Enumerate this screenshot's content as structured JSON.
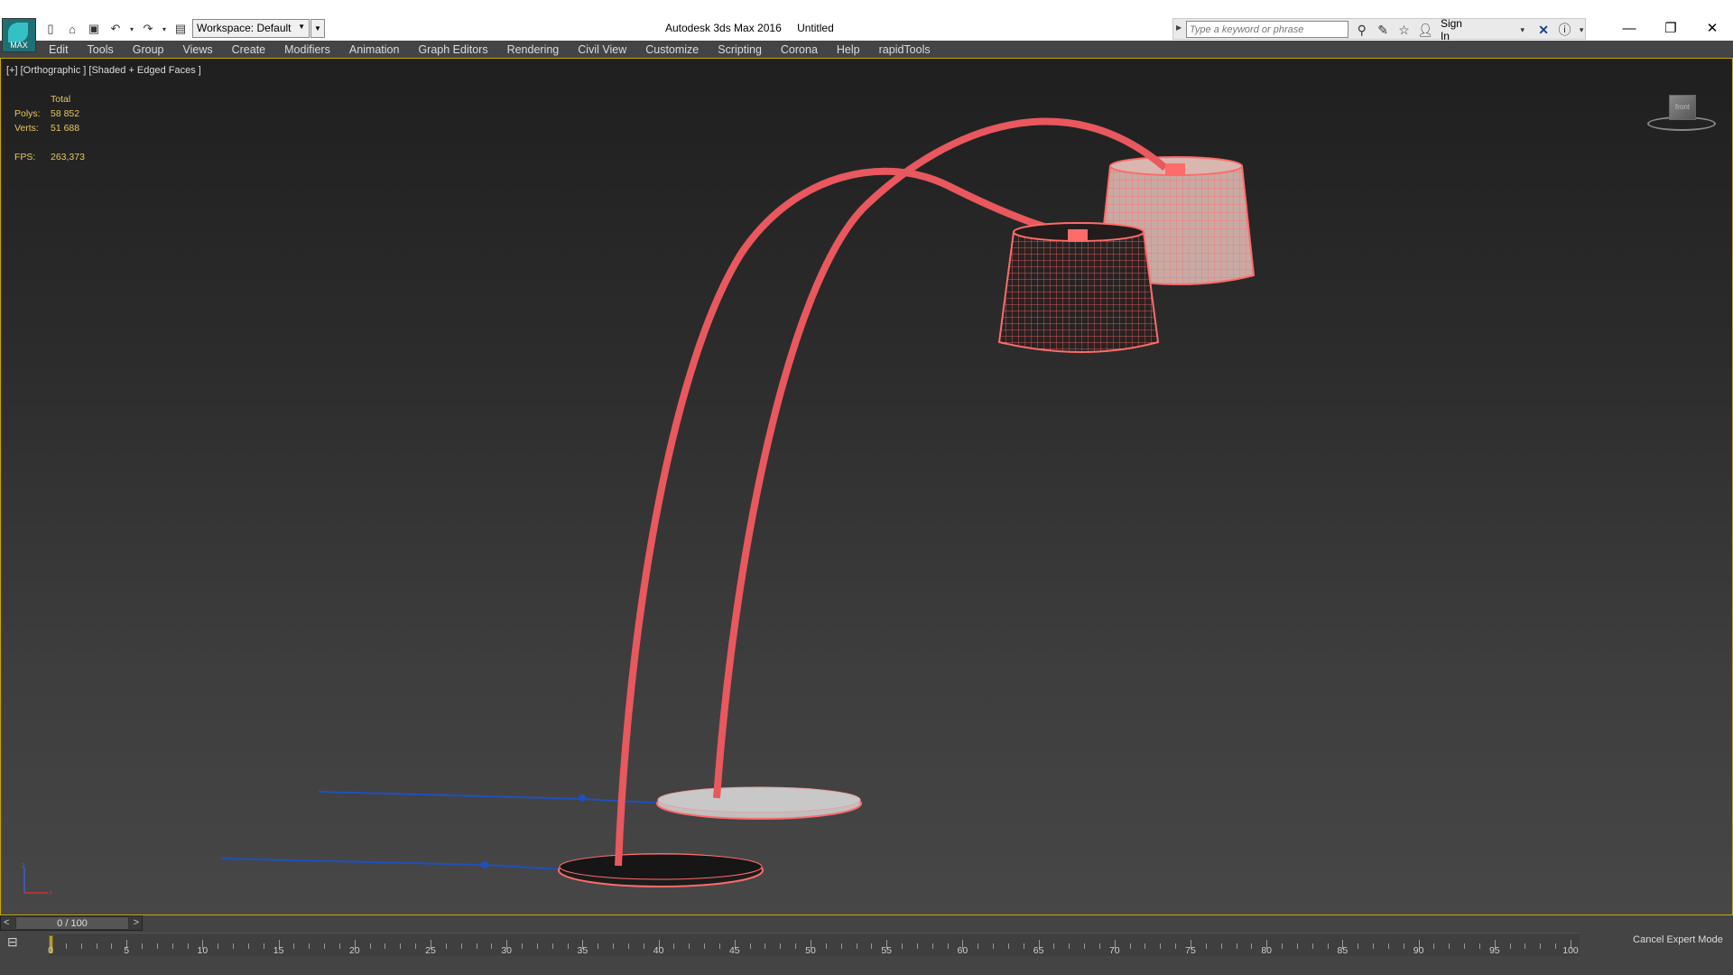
{
  "titlebar": {
    "app_name": "Autodesk 3ds Max 2016",
    "doc_name": "Untitled",
    "logo_text": "MAX",
    "workspace_label": "Workspace: Default",
    "search_placeholder": "Type a keyword or phrase",
    "sign_in": "Sign In"
  },
  "menu": [
    "Edit",
    "Tools",
    "Group",
    "Views",
    "Create",
    "Modifiers",
    "Animation",
    "Graph Editors",
    "Rendering",
    "Civil View",
    "Customize",
    "Scripting",
    "Corona",
    "Help",
    "rapidTools"
  ],
  "viewport": {
    "label": "[+] [Orthographic ] [Shaded + Edged Faces ]",
    "stats": {
      "total_label": "Total",
      "polys_label": "Polys:",
      "polys_value": "58 852",
      "verts_label": "Verts:",
      "verts_value": "51 688",
      "fps_label": "FPS:",
      "fps_value": "263,373"
    },
    "viewcube_label": "front"
  },
  "timeline": {
    "frame_display": "0 / 100",
    "prev": "<",
    "next": ">",
    "ruler_labels": [
      "0",
      "5",
      "10",
      "15",
      "20",
      "25",
      "30",
      "35",
      "40",
      "45",
      "50",
      "55",
      "60",
      "65",
      "70",
      "75",
      "80",
      "85",
      "90",
      "95",
      "100"
    ],
    "current_frame": 0,
    "cancel_expert": "Cancel Expert Mode"
  },
  "colors": {
    "selection": "#ff6b6b",
    "spline": "#1f4fbf",
    "viewport_border": "#c8a800",
    "stats_text": "#e8c860"
  }
}
